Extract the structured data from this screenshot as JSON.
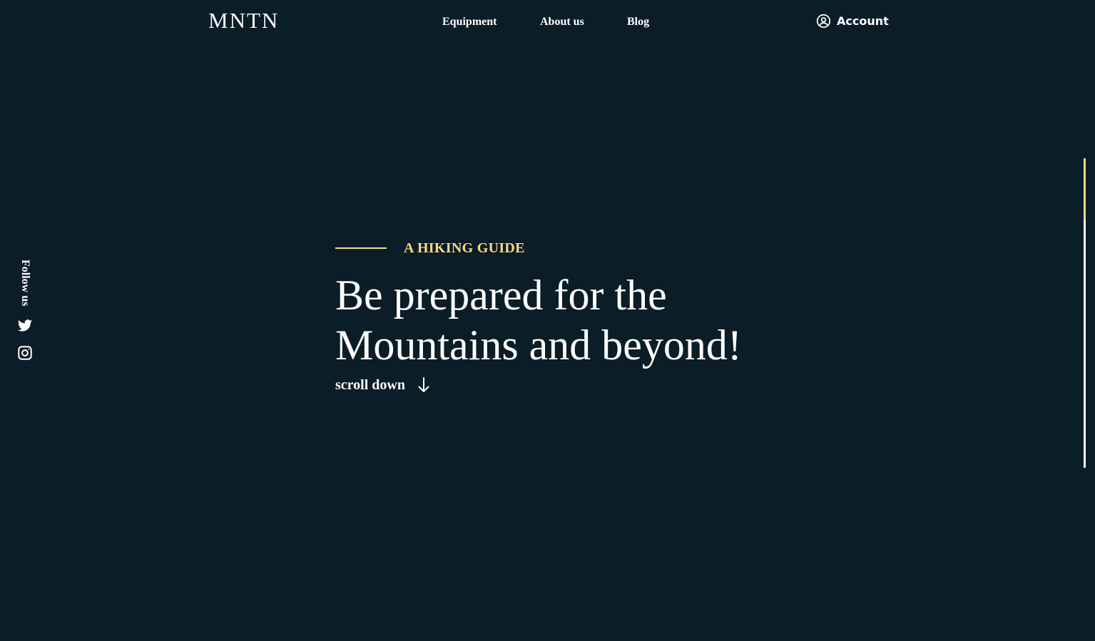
{
  "theme": {
    "background": "#0b1d26",
    "accent": "#fbd784",
    "text": "#ffffff"
  },
  "header": {
    "logo": "MNTN",
    "nav": [
      {
        "label": "Equipment"
      },
      {
        "label": "About us"
      },
      {
        "label": "Blog"
      }
    ],
    "account": {
      "icon": "user-circle-icon",
      "label": "Account"
    }
  },
  "social": {
    "label": "Follow us",
    "links": [
      {
        "icon": "twitter-icon"
      },
      {
        "icon": "instagram-icon"
      }
    ]
  },
  "hero": {
    "eyebrow": "A HIKING GUIDE",
    "headline": "Be prepared for the Mountains and beyond!",
    "scroll_label": "scroll down",
    "scroll_icon": "arrow-down-icon"
  },
  "scroll_progress": {
    "value": 0.2
  }
}
